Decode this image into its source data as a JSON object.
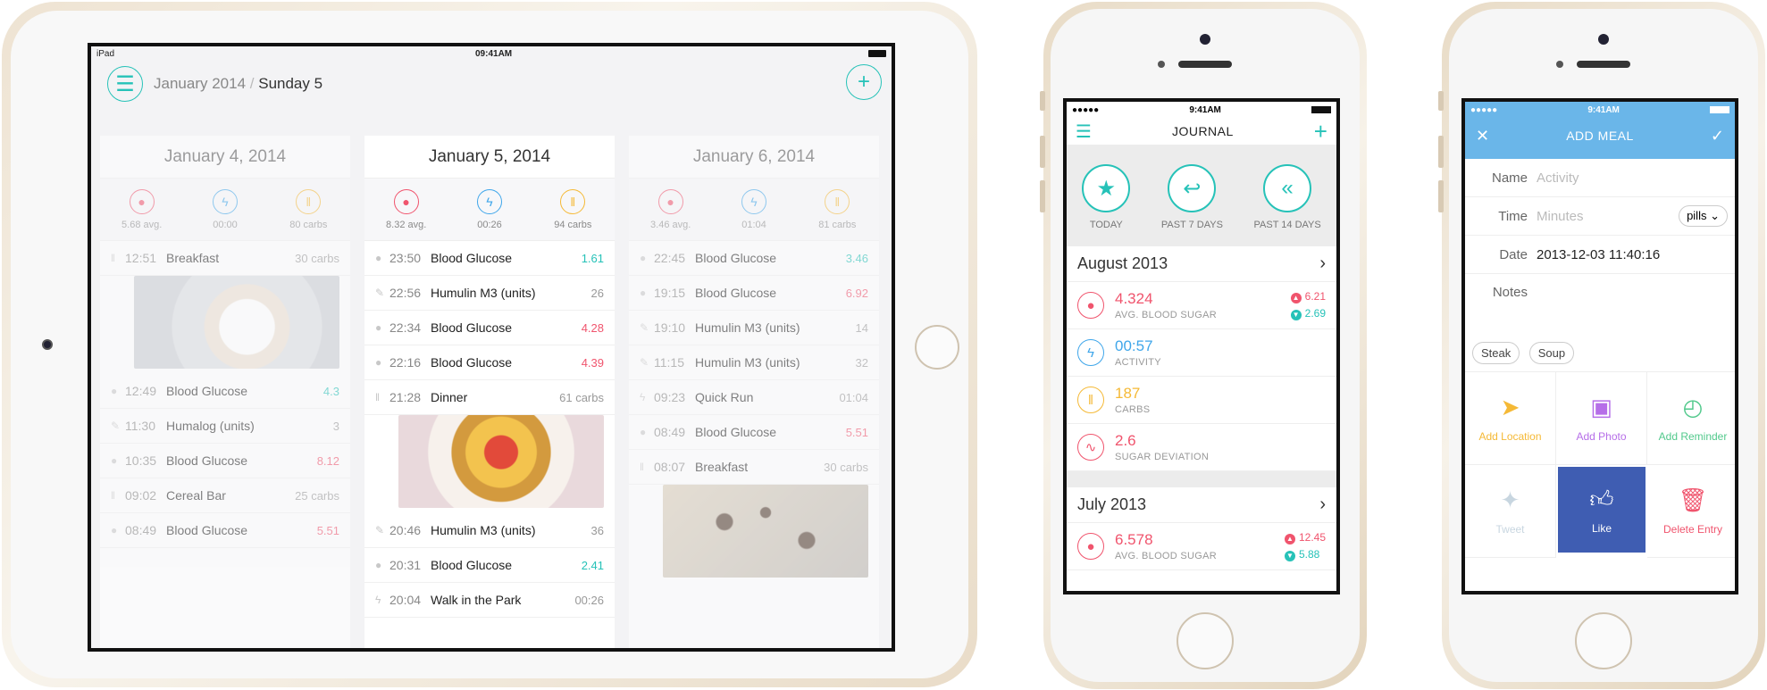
{
  "ipad": {
    "status": {
      "device": "iPad",
      "time": "09:41AM"
    },
    "header": {
      "month": "January 2014",
      "separator": "/",
      "day": "Sunday 5"
    },
    "icons": {
      "menu": "hamburger-icon",
      "add": "plus-icon"
    },
    "columns": [
      {
        "title": "January 4, 2014",
        "stats": {
          "glucose": "5.68 avg.",
          "activity": "00:00",
          "carbs": "80 carbs"
        },
        "entries": [
          {
            "time": "12:51",
            "label": "Breakfast",
            "value": "30 carbs",
            "icon": "fork-icon",
            "photo": "pastry"
          },
          {
            "time": "12:49",
            "label": "Blood Glucose",
            "value": "4.3",
            "icon": "drop-icon",
            "tone": "teal"
          },
          {
            "time": "11:30",
            "label": "Humalog (units)",
            "value": "3",
            "icon": "syringe-icon"
          },
          {
            "time": "10:35",
            "label": "Blood Glucose",
            "value": "8.12",
            "icon": "drop-icon",
            "tone": "red"
          },
          {
            "time": "09:02",
            "label": "Cereal Bar",
            "value": "25 carbs",
            "icon": "fork-icon"
          },
          {
            "time": "08:49",
            "label": "Blood Glucose",
            "value": "5.51",
            "icon": "drop-icon",
            "tone": "red"
          }
        ]
      },
      {
        "title": "January 5, 2014",
        "stats": {
          "glucose": "8.32 avg.",
          "activity": "00:26",
          "carbs": "94 carbs"
        },
        "entries": [
          {
            "time": "23:50",
            "label": "Blood Glucose",
            "value": "1.61",
            "icon": "drop-icon",
            "tone": "teal"
          },
          {
            "time": "22:56",
            "label": "Humulin M3 (units)",
            "value": "26",
            "icon": "syringe-icon"
          },
          {
            "time": "22:34",
            "label": "Blood Glucose",
            "value": "4.28",
            "icon": "drop-icon",
            "tone": "red"
          },
          {
            "time": "22:16",
            "label": "Blood Glucose",
            "value": "4.39",
            "icon": "drop-icon",
            "tone": "red"
          },
          {
            "time": "21:28",
            "label": "Dinner",
            "value": "61 carbs",
            "icon": "fork-icon",
            "photo": "dinner"
          },
          {
            "time": "20:46",
            "label": "Humulin M3 (units)",
            "value": "36",
            "icon": "syringe-icon"
          },
          {
            "time": "20:31",
            "label": "Blood Glucose",
            "value": "2.41",
            "icon": "drop-icon",
            "tone": "teal"
          },
          {
            "time": "20:04",
            "label": "Walk in the Park",
            "value": "00:26",
            "icon": "bolt-icon"
          }
        ]
      },
      {
        "title": "January 6, 2014",
        "stats": {
          "glucose": "3.46 avg.",
          "activity": "01:04",
          "carbs": "81 carbs"
        },
        "entries": [
          {
            "time": "22:45",
            "label": "Blood Glucose",
            "value": "3.46",
            "icon": "drop-icon",
            "tone": "teal"
          },
          {
            "time": "19:15",
            "label": "Blood Glucose",
            "value": "6.92",
            "icon": "drop-icon",
            "tone": "red"
          },
          {
            "time": "19:10",
            "label": "Humulin M3 (units)",
            "value": "14",
            "icon": "syringe-icon"
          },
          {
            "time": "11:15",
            "label": "Humulin M3 (units)",
            "value": "32",
            "icon": "syringe-icon"
          },
          {
            "time": "09:23",
            "label": "Quick Run",
            "value": "01:04",
            "icon": "bolt-icon"
          },
          {
            "time": "08:49",
            "label": "Blood Glucose",
            "value": "5.51",
            "icon": "drop-icon",
            "tone": "red"
          },
          {
            "time": "08:07",
            "label": "Breakfast",
            "value": "30 carbs",
            "icon": "fork-icon",
            "photo": "cookies"
          }
        ]
      }
    ]
  },
  "journal": {
    "status_time": "9:41AM",
    "title": "JOURNAL",
    "filters": [
      {
        "label": "TODAY",
        "icon": "star-icon"
      },
      {
        "label": "PAST 7 DAYS",
        "icon": "reply-icon"
      },
      {
        "label": "PAST 14 DAYS",
        "icon": "reply-all-icon"
      }
    ],
    "sections": [
      {
        "month": "August 2013",
        "rows": [
          {
            "value": "4.324",
            "label": "AVG. BLOOD SUGAR",
            "icon": "drop-icon",
            "tone": "red",
            "up": "6.21",
            "down": "2.69"
          },
          {
            "value": "00:57",
            "label": "ACTIVITY",
            "icon": "bolt-icon",
            "tone": "blue"
          },
          {
            "value": "187",
            "label": "CARBS",
            "icon": "fork-icon",
            "tone": "yellow"
          },
          {
            "value": "2.6",
            "label": "SUGAR DEVIATION",
            "icon": "pulse-icon",
            "tone": "red"
          }
        ]
      },
      {
        "month": "July 2013",
        "rows": [
          {
            "value": "6.578",
            "label": "AVG. BLOOD SUGAR",
            "icon": "drop-icon",
            "tone": "red",
            "up": "12.45",
            "down": "5.88"
          }
        ]
      }
    ]
  },
  "add_meal": {
    "status_time": "9:41AM",
    "title": "ADD MEAL",
    "fields": {
      "name_label": "Name",
      "name_placeholder": "Activity",
      "time_label": "Time",
      "time_placeholder": "Minutes",
      "time_unit": "pills",
      "date_label": "Date",
      "date_value": "2013-12-03 11:40:16",
      "notes_label": "Notes"
    },
    "tags": [
      "Steak",
      "Soup"
    ],
    "actions": [
      {
        "label": "Add Location",
        "icon": "location-arrow-icon",
        "color": "#f5b936"
      },
      {
        "label": "Add Photo",
        "icon": "camera-icon",
        "color": "#b66ee8"
      },
      {
        "label": "Add Reminder",
        "icon": "stopwatch-icon",
        "color": "#52c98c"
      },
      {
        "label": "Tweet",
        "icon": "twitter-bird-icon",
        "color": "#c8d6e0"
      },
      {
        "label": "Like",
        "icon": "thumbs-up-icon",
        "color": "#ffffff"
      },
      {
        "label": "Delete Entry",
        "icon": "trash-icon",
        "color": "#f0546d"
      }
    ],
    "colors": {
      "header": "#6ab6e9",
      "like_bg": "#3f5db2"
    }
  }
}
